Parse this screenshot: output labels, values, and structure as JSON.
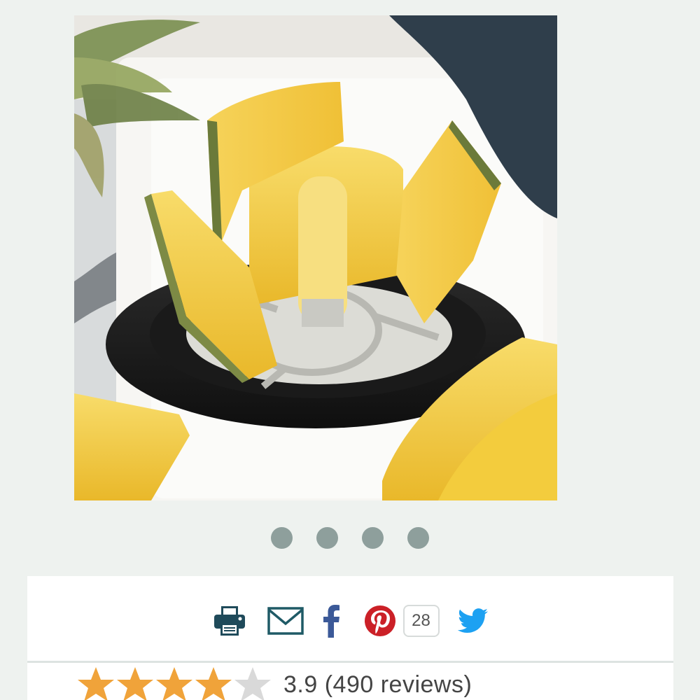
{
  "product": {
    "image_alt": "",
    "carousel": {
      "slide_count": 4,
      "active_index": 0
    }
  },
  "share": {
    "items": [
      {
        "icon": "print-icon",
        "color": "#1f4a5a"
      },
      {
        "icon": "email-icon",
        "color": "#1f4a5a"
      },
      {
        "icon": "facebook-icon",
        "color": "#3b5998"
      },
      {
        "icon": "pinterest-icon",
        "color": "#cb2027"
      },
      {
        "icon": "twitter-icon",
        "color": "#1da1f2"
      }
    ],
    "pinterest_count": "28"
  },
  "rating": {
    "value": 3.9,
    "max": 5,
    "filled_stars": 4,
    "star_color": "#f0a33a",
    "empty_star_color": "#d9d9d9",
    "rating_number": "3.9",
    "reviews_label": "(490 reviews)"
  }
}
